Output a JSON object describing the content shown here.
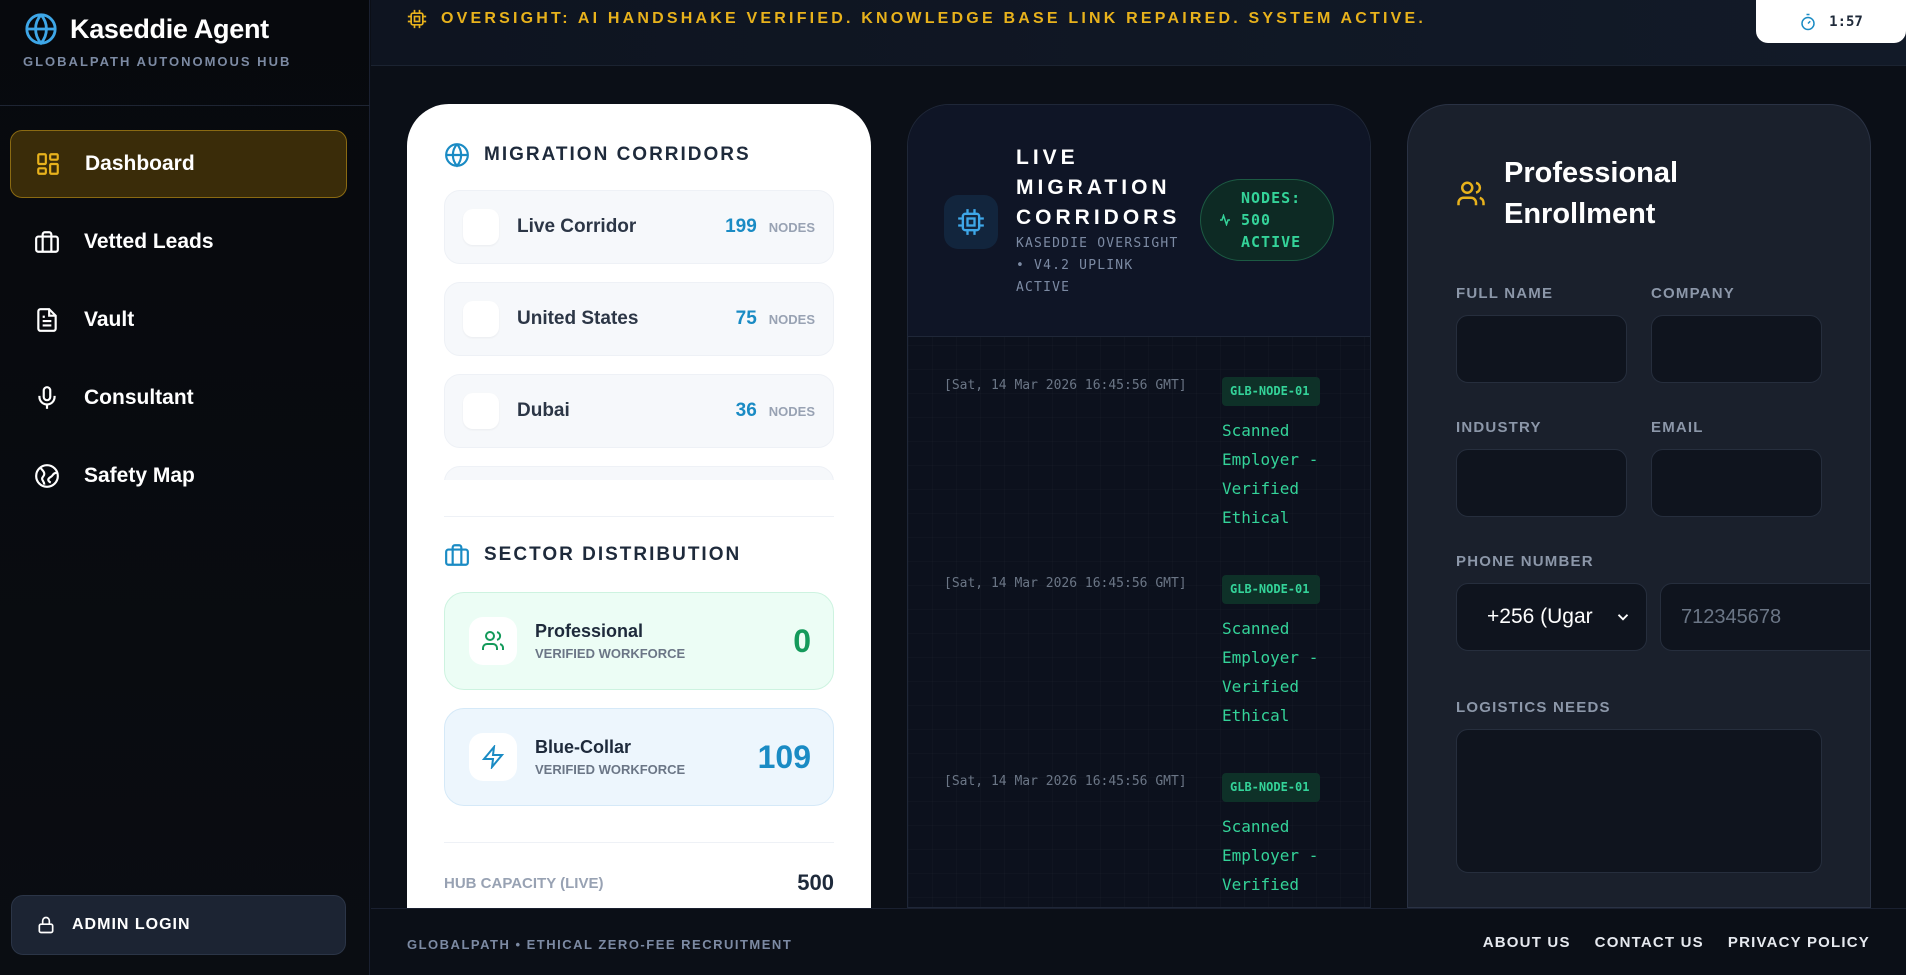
{
  "sidebar": {
    "brand_title": "Kaseddie Agent",
    "brand_subtitle": "GLOBALPATH AUTONOMOUS HUB",
    "items": [
      {
        "label": "Dashboard",
        "icon": "dashboard-grid-icon",
        "active": true
      },
      {
        "label": "Vetted Leads",
        "icon": "briefcase-icon",
        "active": false
      },
      {
        "label": "Vault",
        "icon": "document-icon",
        "active": false
      },
      {
        "label": "Consultant",
        "icon": "microphone-icon",
        "active": false
      },
      {
        "label": "Safety Map",
        "icon": "globe-icon",
        "active": false
      }
    ],
    "admin_label": "ADMIN LOGIN"
  },
  "topbar": {
    "oversight_text": "OVERSIGHT: AI HANDSHAKE VERIFIED. KNOWLEDGE BASE LINK REPAIRED. SYSTEM ACTIVE.",
    "timer": "1:57"
  },
  "corridors_card": {
    "title": "MIGRATION CORRIDORS",
    "items": [
      {
        "name": "Live Corridor",
        "count": "199",
        "unit": "NODES"
      },
      {
        "name": "United States",
        "count": "75",
        "unit": "NODES"
      },
      {
        "name": "Dubai",
        "count": "36",
        "unit": "NODES"
      }
    ],
    "sector_title": "SECTOR DISTRIBUTION",
    "sectors": [
      {
        "title": "Professional",
        "subtitle": "VERIFIED WORKFORCE",
        "value": "0"
      },
      {
        "title": "Blue-Collar",
        "subtitle": "VERIFIED WORKFORCE",
        "value": "109"
      }
    ],
    "hub_capacity_label": "HUB CAPACITY (LIVE)",
    "hub_capacity_value": "500"
  },
  "live_card": {
    "title": "LIVE MIGRATION CORRIDORS",
    "subtitle": "KASEDDIE OVERSIGHT • V4.2 UPLINK ACTIVE",
    "nodes_badge": "NODES: 500 ACTIVE",
    "logs": [
      {
        "timestamp": "[Sat, 14 Mar 2026 16:45:56 GMT]",
        "node": "GLB-NODE-01",
        "message": "Scanned Employer - Verified Ethical"
      },
      {
        "timestamp": "[Sat, 14 Mar 2026 16:45:56 GMT]",
        "node": "GLB-NODE-01",
        "message": "Scanned Employer - Verified Ethical"
      },
      {
        "timestamp": "[Sat, 14 Mar 2026 16:45:56 GMT]",
        "node": "GLB-NODE-01",
        "message": "Scanned Employer - Verified"
      }
    ]
  },
  "enrollment": {
    "title": "Professional Enrollment",
    "full_name_label": "FULL NAME",
    "company_label": "COMPANY",
    "industry_label": "INDUSTRY",
    "email_label": "EMAIL",
    "phone_label": "PHONE NUMBER",
    "country_code": "+256 (Ugar",
    "phone_placeholder": "712345678",
    "logistics_label": "LOGISTICS NEEDS"
  },
  "footer": {
    "copyright": "GLOBALPATH • ETHICAL ZERO-FEE RECRUITMENT",
    "links": [
      "ABOUT US",
      "CONTACT US",
      "PRIVACY POLICY"
    ]
  },
  "colors": {
    "accent_gold": "#e8b21c",
    "accent_green": "#34d399",
    "accent_blue": "#1a8bc4",
    "background": "#0b0f17"
  }
}
